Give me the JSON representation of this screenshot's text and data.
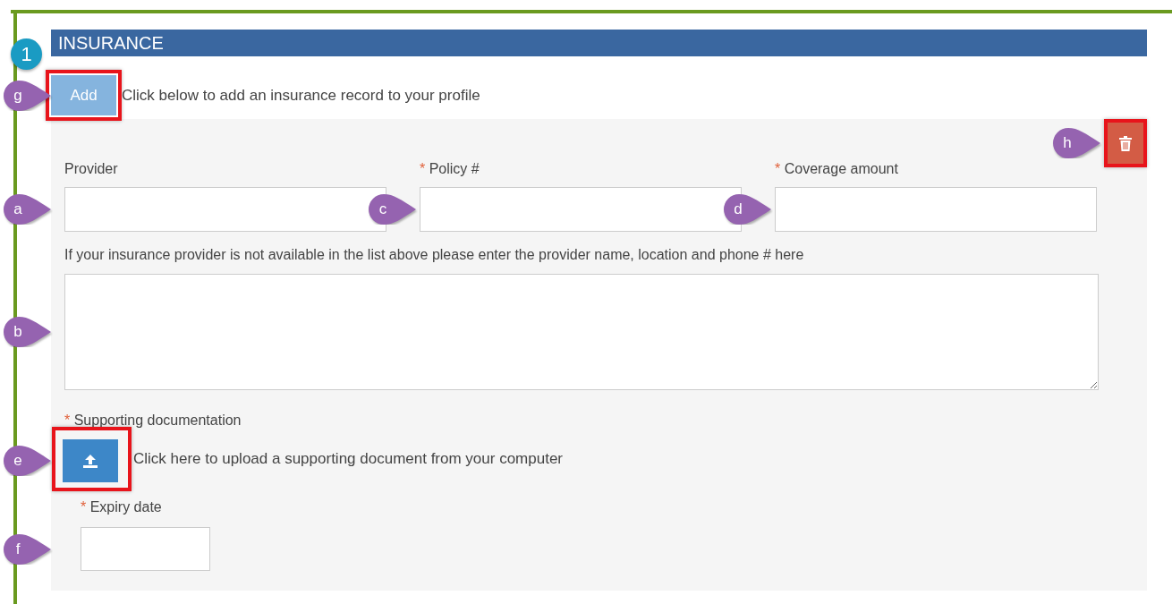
{
  "section": {
    "step": "1",
    "title": "INSURANCE"
  },
  "required_mark": "*",
  "add": {
    "label": "Add",
    "hint": "Click below to add an insurance record to your profile",
    "callout": "g",
    "highlighted": true
  },
  "delete": {
    "callout": "h",
    "highlighted": true
  },
  "fields": [
    {
      "label": "Provider",
      "required": false,
      "callout": "a"
    },
    {
      "label": "Policy #",
      "required": true,
      "callout": "c"
    },
    {
      "label": "Coverage amount",
      "required": true,
      "callout": "d"
    }
  ],
  "other_provider": {
    "label": "If your insurance provider is not available in the list above please enter the provider name, location and phone # here",
    "callout": "b"
  },
  "documentation": {
    "label": "Supporting documentation",
    "required": true,
    "hint": "Click here to upload a supporting document from your computer",
    "callout": "e",
    "highlighted": true
  },
  "expiry": {
    "label": "Expiry date",
    "required": true,
    "callout": "f"
  }
}
